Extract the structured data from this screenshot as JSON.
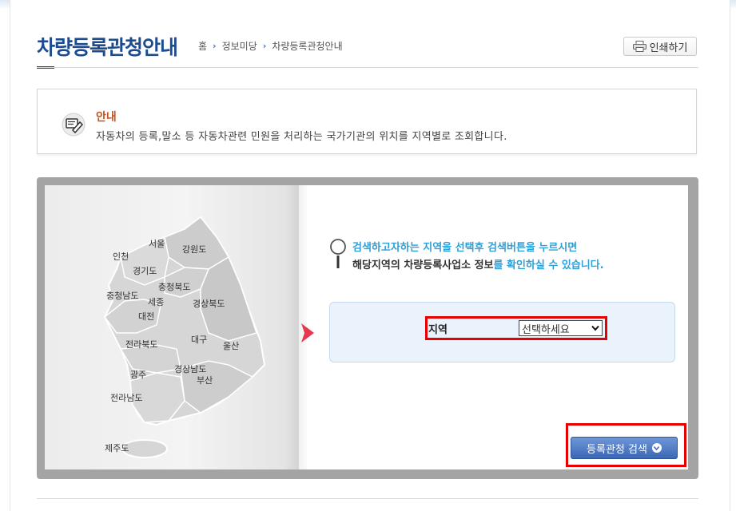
{
  "header": {
    "page_title": "차량등록관청안내",
    "breadcrumb": [
      "홈",
      "정보미당",
      "차량등록관청안내"
    ],
    "print_label": "인쇄하기"
  },
  "info": {
    "title": "안내",
    "text": "자동차의 등록,말소 등 자동차관련 민원을 처리하는 국가기관의 위치를 지역별로 조회합니다."
  },
  "map": {
    "regions": [
      "서울",
      "인천",
      "강원도",
      "경기도",
      "충청북도",
      "충청남도",
      "세종",
      "대전",
      "경상북도",
      "전라북도",
      "대구",
      "울산",
      "광주",
      "경상남도",
      "부산",
      "전라남도",
      "제주도"
    ]
  },
  "guide": {
    "line1": "검색하고자하는 지역을 선택후 검색버튼을 누르시면",
    "line2_part1": "해당지역의 차량등록사업소 정보",
    "line2_part2": "를 확인하실 수 있습니다."
  },
  "search": {
    "region_label": "지역",
    "region_select_value": "선택하세요",
    "button_label": "등록관청 검색"
  },
  "colors": {
    "title_blue": "#1d4b8f",
    "info_orange": "#c8521c",
    "guide_blue": "#2f9fd8",
    "highlight_red": "#e60000",
    "arrow_red": "#e8384f"
  }
}
